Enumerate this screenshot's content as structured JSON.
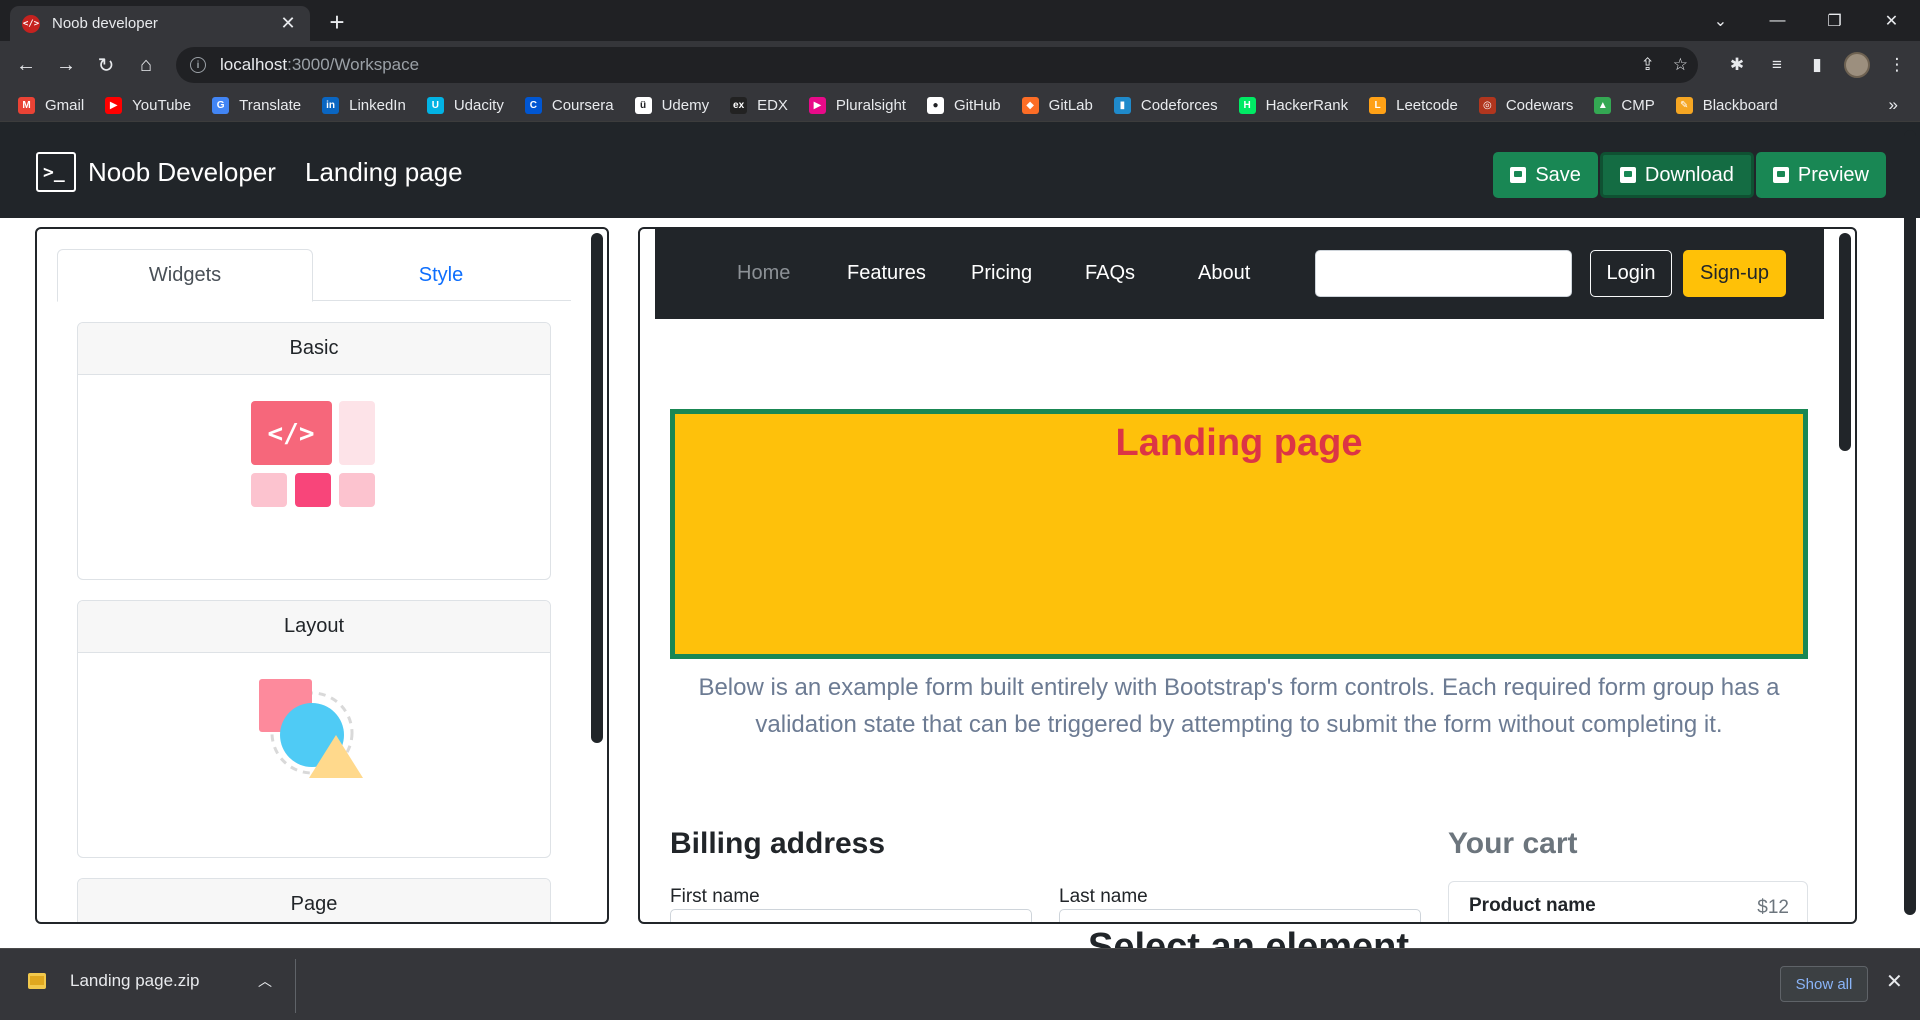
{
  "browser": {
    "tab_title": "Noob developer",
    "url_host": "localhost",
    "url_path": ":3000/Workspace",
    "bookmarks": [
      {
        "label": "Gmail",
        "icon": "gmail-icon",
        "color": "#ea4335",
        "glyph": "M"
      },
      {
        "label": "YouTube",
        "icon": "youtube-icon",
        "color": "#ff0000",
        "glyph": "▶"
      },
      {
        "label": "Translate",
        "icon": "translate-icon",
        "color": "#4285f4",
        "glyph": "G"
      },
      {
        "label": "LinkedIn",
        "icon": "linkedin-icon",
        "color": "#0a66c2",
        "glyph": "in"
      },
      {
        "label": "Udacity",
        "icon": "udacity-icon",
        "color": "#02b3e4",
        "glyph": "U"
      },
      {
        "label": "Coursera",
        "icon": "coursera-icon",
        "color": "#0056d2",
        "glyph": "C"
      },
      {
        "label": "Udemy",
        "icon": "udemy-icon",
        "color": "#ffffff",
        "glyph": "ü"
      },
      {
        "label": "EDX",
        "icon": "edx-icon",
        "color": "#222222",
        "glyph": "ex"
      },
      {
        "label": "Pluralsight",
        "icon": "pluralsight-icon",
        "color": "#e80a89",
        "glyph": "▶"
      },
      {
        "label": "GitHub",
        "icon": "github-icon",
        "color": "#ffffff",
        "glyph": "●"
      },
      {
        "label": "GitLab",
        "icon": "gitlab-icon",
        "color": "#fc6d26",
        "glyph": "◆"
      },
      {
        "label": "Codeforces",
        "icon": "codeforces-icon",
        "color": "#1f8acb",
        "glyph": "▮"
      },
      {
        "label": "HackerRank",
        "icon": "hackerrank-icon",
        "color": "#00ea64",
        "glyph": "H"
      },
      {
        "label": "Leetcode",
        "icon": "leetcode-icon",
        "color": "#ffa116",
        "glyph": "L"
      },
      {
        "label": "Codewars",
        "icon": "codewars-icon",
        "color": "#b1361e",
        "glyph": "◎"
      },
      {
        "label": "CMP",
        "icon": "google-drive-icon",
        "color": "#34a853",
        "glyph": "▲"
      },
      {
        "label": "Blackboard",
        "icon": "blackboard-icon",
        "color": "#f5a623",
        "glyph": "✎"
      }
    ]
  },
  "app": {
    "brand": "Noob Developer",
    "page_name": "Landing page",
    "save_label": "Save",
    "download_label": "Download",
    "preview_label": "Preview"
  },
  "sidebar": {
    "tabs": [
      "Widgets",
      "Style"
    ],
    "cards": [
      "Basic",
      "Layout",
      "Page"
    ]
  },
  "preview": {
    "nav_links": [
      "Home",
      "Features",
      "Pricing",
      "FAQs",
      "About"
    ],
    "login_label": "Login",
    "signup_label": "Sign-up",
    "hero_title": "Landing page",
    "lead": "Below is an example form built entirely with Bootstrap's form controls. Each required form group has a validation state that can be triggered by attempting to submit the form without completing it.",
    "billing_title": "Billing address",
    "first_name_label": "First name",
    "last_name_label": "Last name",
    "cart_title": "Your cart",
    "cart_item_name": "Product name",
    "cart_item_price": "$12"
  },
  "overlay_text": "Select an element",
  "downloads": {
    "file_name": "Landing page.zip",
    "show_all_label": "Show all"
  },
  "colors": {
    "app_nav_bg": "#212529",
    "save_green": "#198754",
    "hero_bg": "#fec10b",
    "hero_border": "#198754",
    "hero_title": "#dc3545",
    "signup_bg": "#ffc107"
  }
}
